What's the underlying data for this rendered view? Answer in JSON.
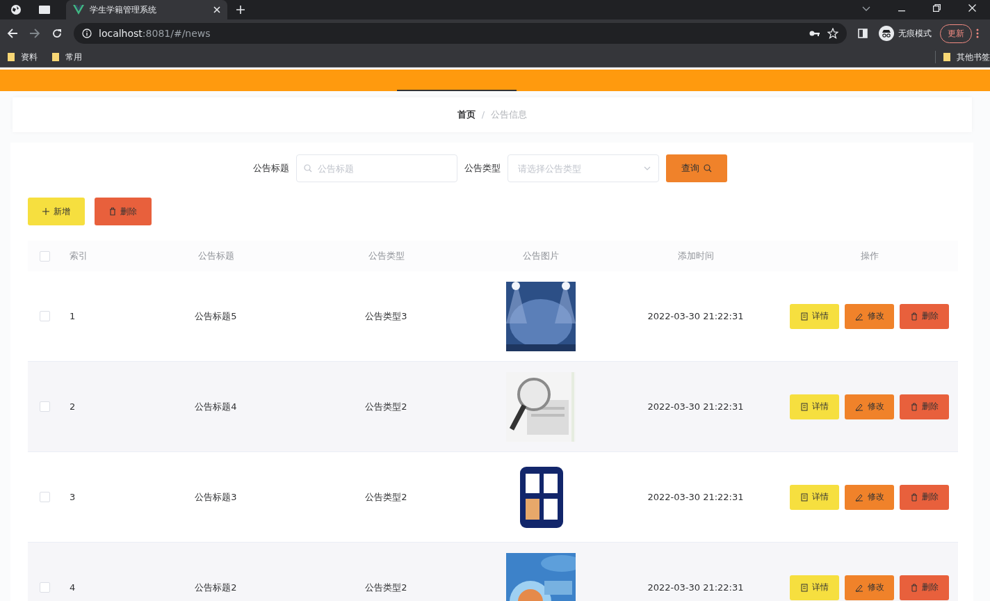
{
  "browser": {
    "tabs": [
      {
        "title": "学生学籍管理系统",
        "selected": true
      }
    ],
    "url": {
      "host": "localhost",
      "rest": ":8081/#/news"
    },
    "profile": "无痕模式",
    "update_button": "更新",
    "bookmarks": [
      "资料",
      "常用"
    ],
    "other_bookmarks": "其他书签"
  },
  "breadcrumb": [
    "首页",
    "公告信息"
  ],
  "breadcrumb_separator": "/",
  "search": {
    "fields": [
      {
        "kind": "text",
        "label": "公告标题",
        "placeholder": "公告标题"
      },
      {
        "kind": "select",
        "label": "公告类型",
        "placeholder": "请选择公告类型"
      }
    ],
    "button": "查询"
  },
  "actions": [
    {
      "kind": "add",
      "label": "新增"
    },
    {
      "kind": "delete",
      "label": "删除"
    }
  ],
  "table": {
    "select_all": {
      "checked": false
    },
    "columns": [
      "索引",
      "公告标题",
      "公告类型",
      "公告图片",
      "添加时间",
      "操作"
    ],
    "rows": [
      {
        "checked": false,
        "index": "1",
        "title": "公告标题5",
        "type": "公告类型3",
        "time": "2022-03-30 21:22:31",
        "buttons": [
          {
            "kind": "detail",
            "label": "详情"
          },
          {
            "kind": "edit",
            "label": "修改"
          },
          {
            "kind": "delete",
            "label": "删除"
          }
        ]
      },
      {
        "checked": false,
        "index": "2",
        "title": "公告标题4",
        "type": "公告类型2",
        "time": "2022-03-30 21:22:31",
        "buttons": [
          {
            "kind": "detail",
            "label": "详情"
          },
          {
            "kind": "edit",
            "label": "修改"
          },
          {
            "kind": "delete",
            "label": "删除"
          }
        ]
      },
      {
        "checked": false,
        "index": "3",
        "title": "公告标题3",
        "type": "公告类型2",
        "time": "2022-03-30 21:22:31",
        "buttons": [
          {
            "kind": "detail",
            "label": "详情"
          },
          {
            "kind": "edit",
            "label": "修改"
          },
          {
            "kind": "delete",
            "label": "删除"
          }
        ]
      },
      {
        "checked": false,
        "index": "4",
        "title": "公告标题2",
        "type": "公告类型2",
        "time": "2022-03-30 21:22:31",
        "buttons": [
          {
            "kind": "detail",
            "label": "详情"
          },
          {
            "kind": "edit",
            "label": "修改"
          },
          {
            "kind": "delete",
            "label": "删除"
          }
        ]
      }
    ]
  }
}
